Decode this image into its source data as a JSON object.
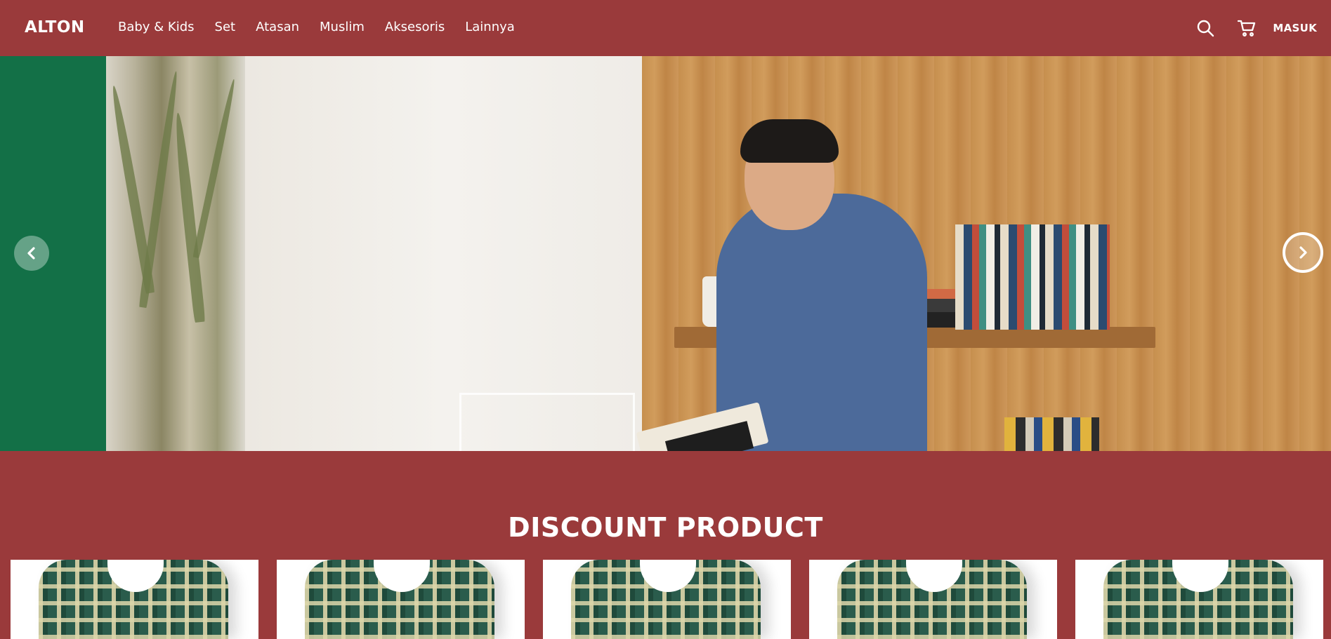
{
  "brand": {
    "logo": "ALTON"
  },
  "nav": {
    "items": [
      {
        "label": "Baby & Kids"
      },
      {
        "label": "Set"
      },
      {
        "label": "Atasan"
      },
      {
        "label": "Muslim"
      },
      {
        "label": "Aksesoris"
      },
      {
        "label": "Lainnya"
      }
    ],
    "search_icon": "search-icon",
    "cart_icon": "cart-icon",
    "login_label": "MASUK"
  },
  "hero": {
    "prev_icon": "chevron-left-icon",
    "next_icon": "chevron-right-icon"
  },
  "discount": {
    "title": "DISCOUNT PRODUCT",
    "products": [
      {
        "image": "plaid-shirt"
      },
      {
        "image": "plaid-shirt"
      },
      {
        "image": "plaid-shirt"
      },
      {
        "image": "plaid-shirt"
      },
      {
        "image": "plaid-shirt"
      }
    ]
  },
  "colors": {
    "primary": "#9a3a3b",
    "hero_green": "#137047",
    "text": "#ffffff"
  }
}
